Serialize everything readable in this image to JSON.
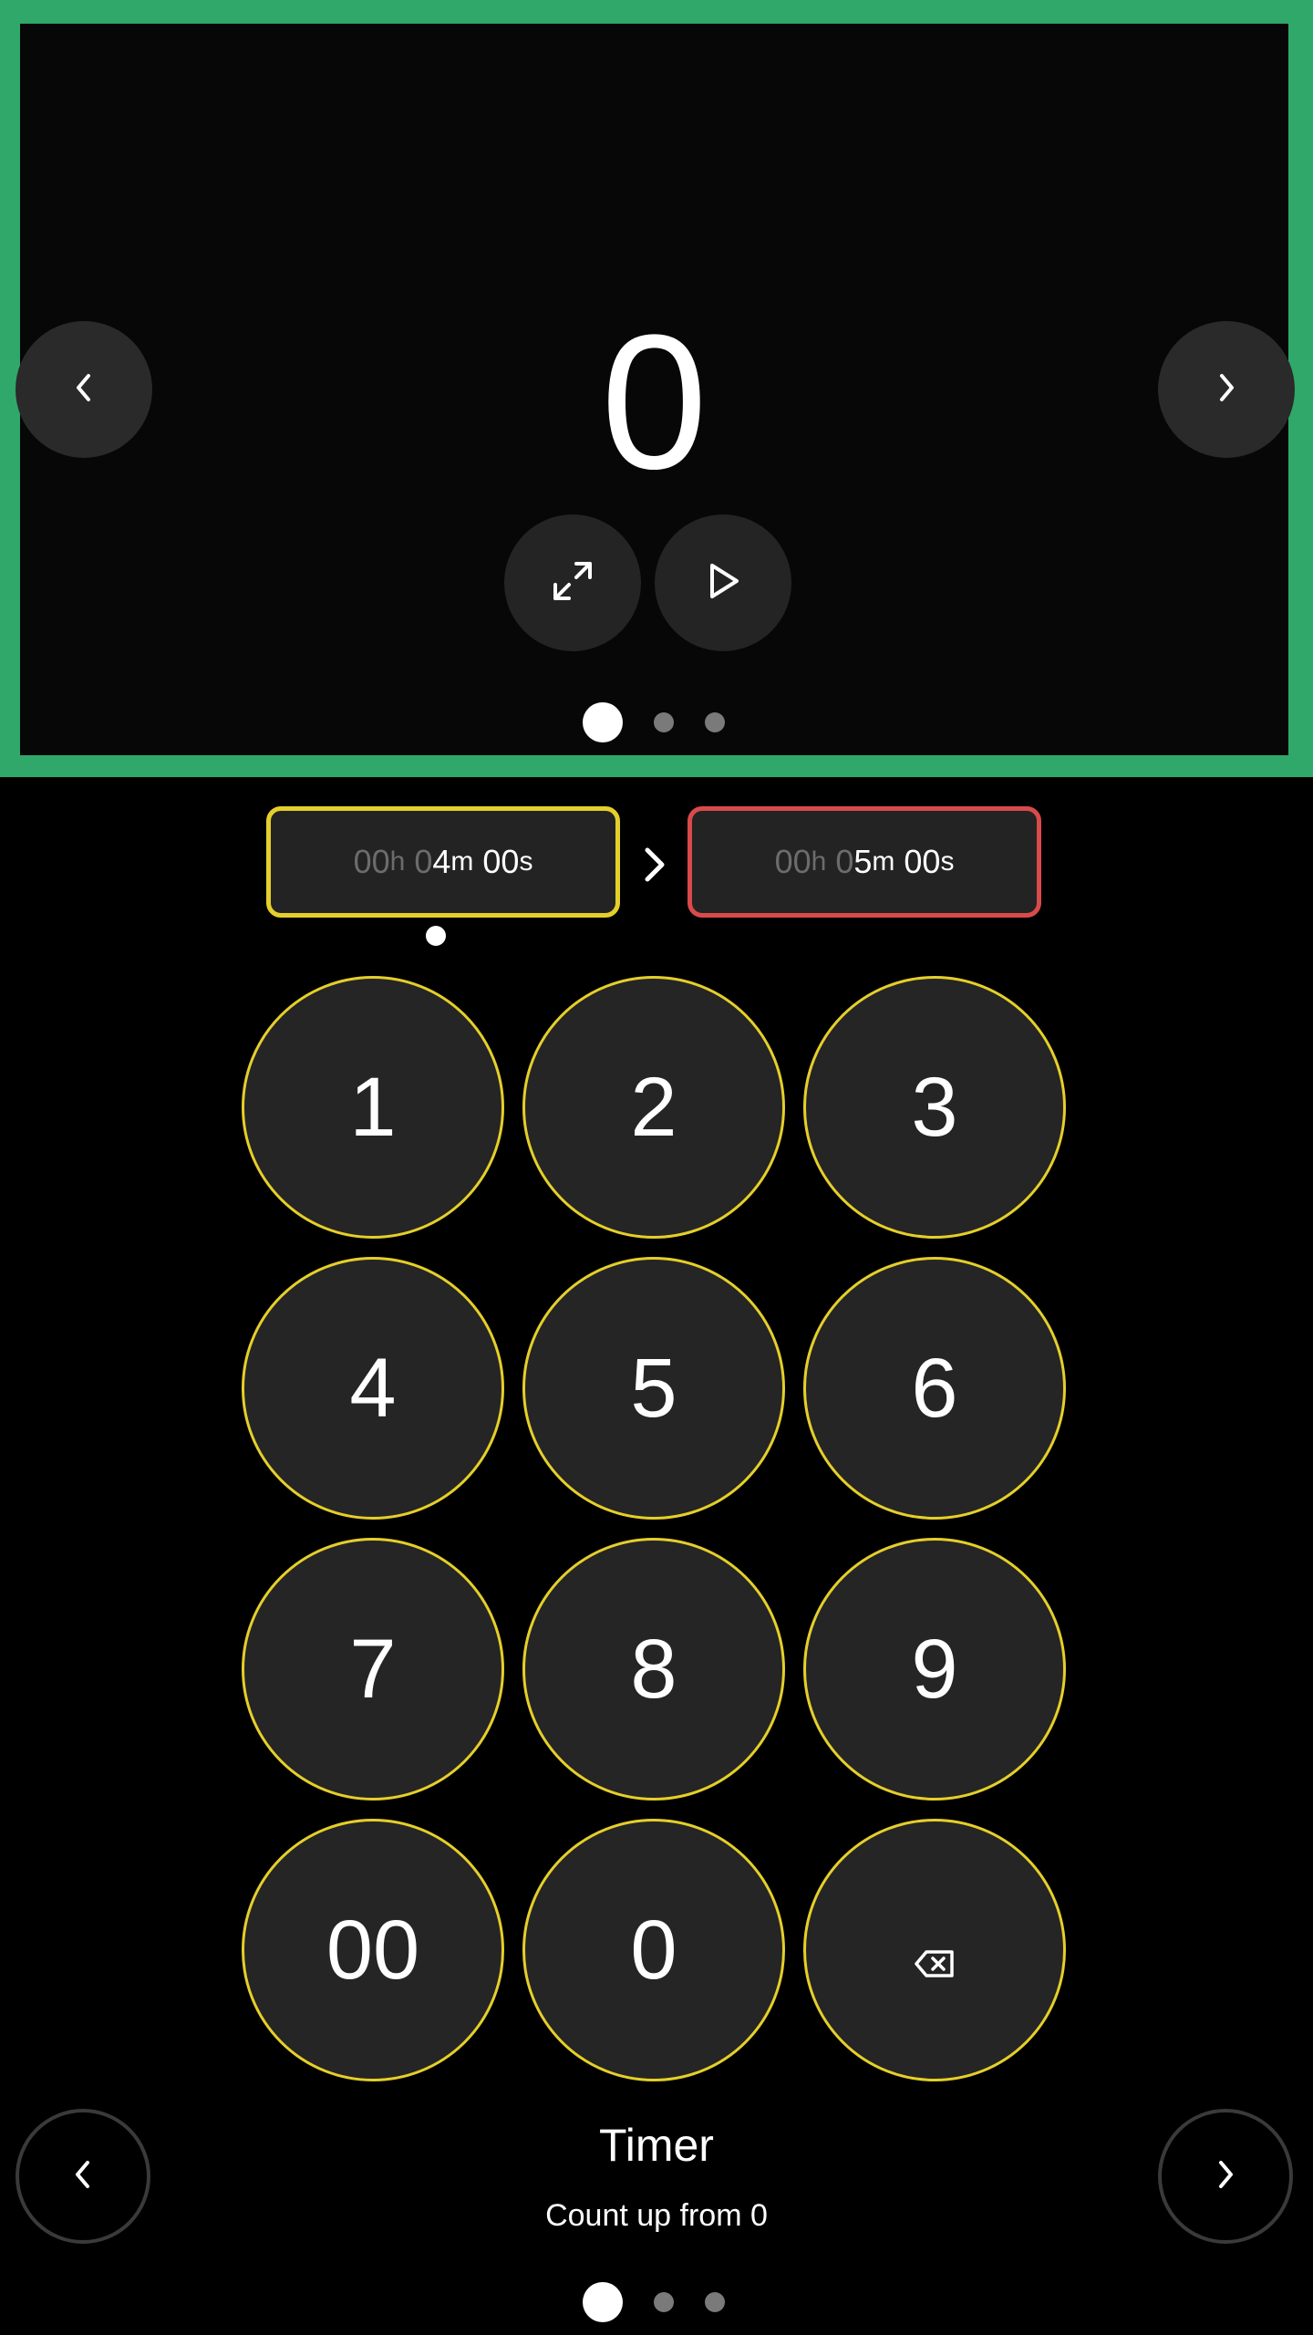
{
  "preview": {
    "value": "0",
    "prev_icon": "chevron-left-icon",
    "next_icon": "chevron-right-icon",
    "fullscreen_icon": "expand-icon",
    "play_icon": "play-icon",
    "page_dots": 3,
    "active_dot": 0,
    "frame_color": "#2fa86a"
  },
  "range": {
    "start": {
      "hours_value": "00",
      "hours_unit": "h",
      "minutes_dim": "0",
      "minutes_value": "4",
      "minutes_unit": "m",
      "seconds_value": "00",
      "seconds_unit": "s",
      "border_color": "#e5cf2a"
    },
    "separator_icon": "chevron-right-icon",
    "end": {
      "hours_value": "00",
      "hours_unit": "h",
      "minutes_dim": "0",
      "minutes_value": "5",
      "minutes_unit": "m",
      "seconds_value": "00",
      "seconds_unit": "s",
      "border_color": "#d94a4a"
    }
  },
  "keypad": {
    "keys": [
      "1",
      "2",
      "3",
      "4",
      "5",
      "6",
      "7",
      "8",
      "9",
      "00",
      "0"
    ],
    "backspace_icon": "backspace-icon",
    "key_border_color": "#e5cf2a"
  },
  "footer": {
    "title": "Timer",
    "subtitle": "Count up from 0",
    "prev_icon": "chevron-left-icon",
    "next_icon": "chevron-right-icon",
    "page_dots": 3,
    "active_dot": 0
  }
}
